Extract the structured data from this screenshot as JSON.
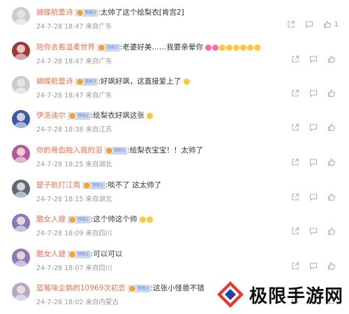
{
  "comments": [
    {
      "name": "蝴蝶航蕾诗",
      "badge": "铁粉3",
      "text": ":太帅了这个绘梨衣[肯宫2]",
      "time": "24-7-28 18:47 来自广东",
      "likes": "1",
      "avatar_color": "#c9cbd6",
      "emoji_count": 0
    },
    {
      "name": "陪你去看温柔世界",
      "badge": "铁粉3",
      "text": ":老婆好美……我要亲晕你",
      "time": "24-7-28 18:47 来自广东",
      "likes": "",
      "avatar_color": "#9c3a3a",
      "emoji_count": 8
    },
    {
      "name": "蝴蝶航蕾诗",
      "badge": "铁粉3",
      "text": ":好飒好飒，这直接爱上了",
      "time": "24-7-28 18:47 来自广东",
      "likes": "",
      "avatar_color": "#c9cbd6",
      "emoji_count": 1
    },
    {
      "name": "伊洛迪尔",
      "badge": "铁粉2",
      "text": ":绘梨衣好飒这张",
      "time": "24-7-28 18:38 来自江苏",
      "likes": "",
      "avatar_color": "#3a5aa8",
      "emoji_count": 1
    },
    {
      "name": "你的骨血融入我的泪",
      "badge": "铁粉3",
      "text": ":绘梨衣宝宝！！太帅了",
      "time": "24-7-28 18:25 来自湖北",
      "likes": "",
      "avatar_color": "#b45a9c",
      "emoji_count": 0
    },
    {
      "name": "楚子航打江南",
      "badge": "铁粉3",
      "text": ":啖不了 这太帅了",
      "time": "24-7-28 18:15 来自湖北",
      "likes": "",
      "avatar_color": "#5a6a7a",
      "emoji_count": 0
    },
    {
      "name": "酷女人嫂",
      "badge": "铁粉2",
      "text": ":这个帅这个帅",
      "time": "24-7-28 18:09 来自四川",
      "likes": "",
      "avatar_color": "#8a7ab8",
      "emoji_count": 2
    },
    {
      "name": "酷女人嫂",
      "badge": "铁粉2",
      "text": ":可以可以",
      "time": "24-7-28 18:07 来自四川",
      "likes": "",
      "avatar_color": "#8a7ab8",
      "emoji_count": 0
    },
    {
      "name": "蓝莓味企鹅的10969次初恋",
      "badge": "铁粉3",
      "text": ":这张小怪兽不错",
      "time": "24-7-28 18:02 来自内蒙古",
      "likes": "",
      "avatar_color": "#b8a8c8",
      "emoji_count": 0
    }
  ],
  "watermark": {
    "text": "极限手游网"
  },
  "colors": {
    "name": "#eb7350",
    "meta": "#999999",
    "text": "#333333"
  }
}
